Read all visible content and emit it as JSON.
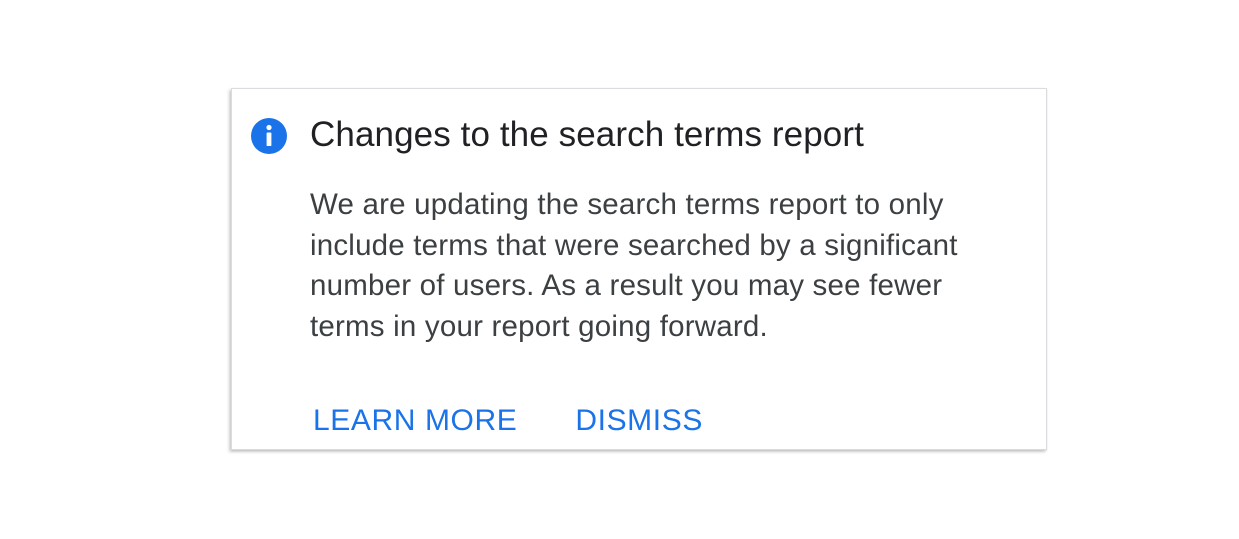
{
  "notice": {
    "icon": "info-icon",
    "accent_color": "#1a73e8",
    "title": "Changes to the search terms report",
    "body_lines": [
      "We are updating the search terms report to only",
      "include terms that were searched by a significant",
      "number of users. As a result you may see fewer",
      "terms in your report going forward."
    ],
    "actions": {
      "learn_more": "LEARN MORE",
      "dismiss": "DISMISS"
    }
  }
}
